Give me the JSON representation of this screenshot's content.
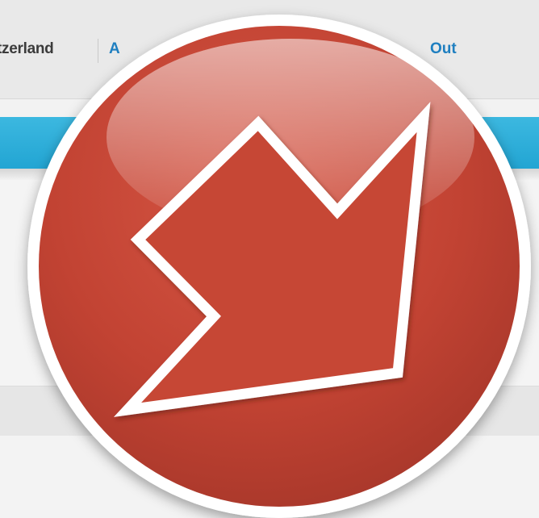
{
  "header": {
    "location_text": "tzerland",
    "account_link": "A",
    "signout_link": "Out"
  },
  "badge": {
    "icon": "arrow-down-right-icon",
    "colors": {
      "circle": "#c84a3a",
      "circle_dark": "#a8352a",
      "ring": "#ffffff",
      "arrow_outline": "#ffffff"
    }
  },
  "colors": {
    "accent_bar": "#29a9d8",
    "link": "#1f7fc0"
  }
}
